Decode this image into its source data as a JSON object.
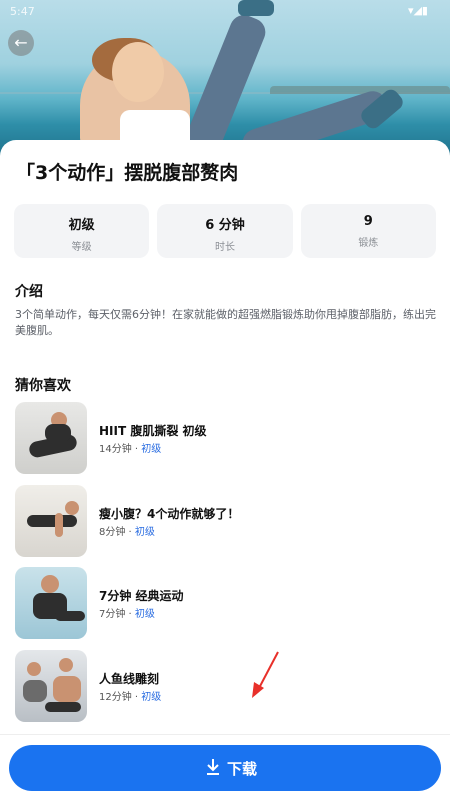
{
  "status_bar": {
    "time": "5:47",
    "icons": "▾◢▮"
  },
  "header": {
    "back_icon": "arrow-left-icon"
  },
  "workout": {
    "title": "「3个动作」摆脱腹部赘肉",
    "stats": [
      {
        "value": "初级",
        "label": "等级"
      },
      {
        "value": "6 分钟",
        "label": "时长"
      },
      {
        "value": "9",
        "label": "锻炼"
      }
    ]
  },
  "intro": {
    "heading": "介绍",
    "text": "3个简单动作，每天仅需6分钟！在家就能做的超强燃脂锻炼助你甩掉腹部脂肪，练出完美腹肌。"
  },
  "recommend": {
    "heading": "猜你喜欢",
    "items": [
      {
        "name": "HIIT 腹肌撕裂 初级",
        "duration": "14分钟 · ",
        "level": "初级"
      },
      {
        "name": "瘦小腹？4个动作就够了！",
        "duration": "8分钟 · ",
        "level": "初级"
      },
      {
        "name": "7分钟 经典运动",
        "duration": "7分钟 · ",
        "level": "初级"
      },
      {
        "name": "人鱼线雕刻",
        "duration": "12分钟 · ",
        "level": "初级"
      }
    ]
  },
  "footer": {
    "download_label": "下载"
  },
  "colors": {
    "accent": "#1a73f0",
    "level_text": "#2b6de1",
    "annotation_arrow": "#e8302a"
  }
}
